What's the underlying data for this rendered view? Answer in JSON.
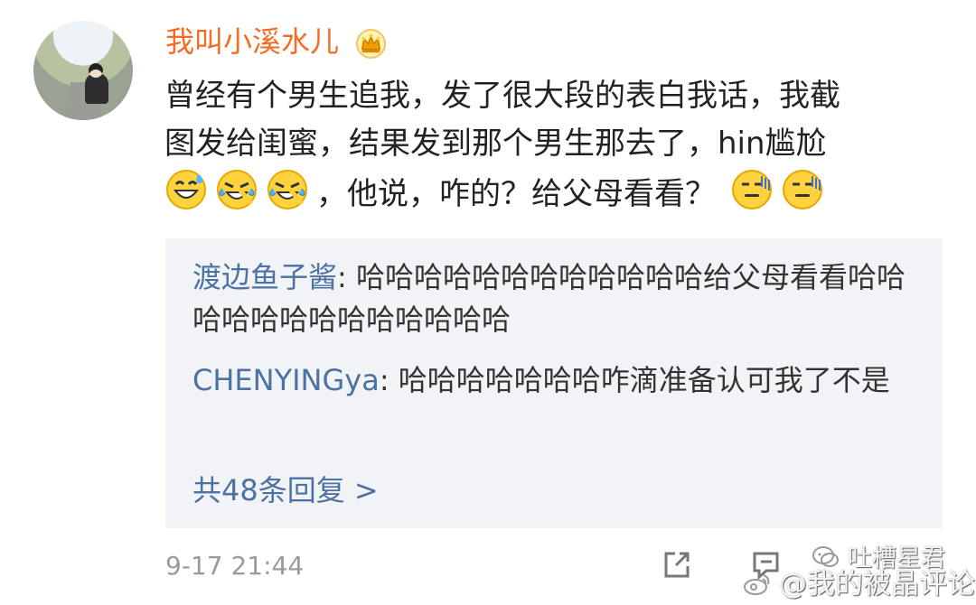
{
  "post": {
    "username": "我叫小溪水儿",
    "line1": "曾经有个男生追我，发了很大段的表白我话，我截",
    "line2": "图发给闺蜜，结果发到那个男生那去了，hin尴尬",
    "line3_text": "，他说，咋的？给父母看看？",
    "emojis": [
      "sweat-smile-emoji",
      "laughing-crying-emoji",
      "laughing-crying-emoji",
      "speechless-emoji",
      "speechless-emoji"
    ],
    "time": "9-17 21:44"
  },
  "replies": [
    {
      "name": "渡边鱼子酱",
      "separator": ": ",
      "text": "哈哈哈哈哈哈哈哈哈哈哈哈给父母看看哈哈哈哈哈哈哈哈哈哈哈哈哈"
    },
    {
      "name": "CHENYINGya",
      "separator": ": ",
      "text": "哈哈哈哈哈哈哈咋滴准备认可我了不是"
    }
  ],
  "more_replies": "共48条回复 >",
  "watermark": {
    "top": "吐槽星君",
    "bottom": "@我的被晶评论"
  },
  "colors": {
    "username": "#f66a22",
    "link": "#4c72a4",
    "reply_background": "#f1f3f6",
    "time": "#9a9a9a"
  },
  "icons": [
    "crown-icon",
    "share-icon",
    "comment-icon",
    "wechat-icon",
    "weibo-icon"
  ]
}
